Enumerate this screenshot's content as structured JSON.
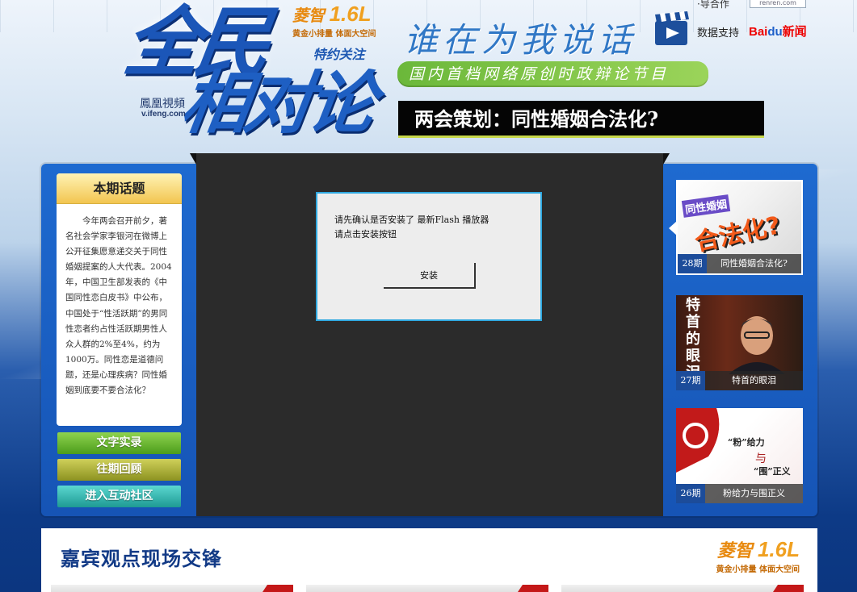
{
  "header": {
    "logo_main": "全民",
    "logo_sub": "相对论",
    "ifeng_cn": "鳳凰視頻",
    "ifeng_en": "v.ifeng.com",
    "sponsor_brand_a": "菱智",
    "sponsor_brand_b": "1.6L",
    "sponsor_line": "黄金小排量  体面大空间",
    "sponsor_tag": "特约关注",
    "slogan": "谁在为我说话",
    "data_support": "数据支持",
    "baidu_a": "Bai",
    "baidu_paw": "du",
    "baidu_b": "新闻",
    "top_right_mini": "·导合作",
    "top_right_badge": "renren.com",
    "tagline": "国内首档网络原创时政辩论节目",
    "topic_banner": "两会策划：同性婚姻合法化?"
  },
  "topic_card": {
    "heading": "本期话题",
    "body": "今年两会召开前夕，著名社会学家李银河在微博上公开征集愿意递交关于同性婚姻提案的人大代表。2004年，中国卫生部发表的《中国同性恋白皮书》中公布，中国处于“性活跃期”的男同性恋者约占性活跃期男性人众人群的2%至4%，约为1000万。同性恋是道德问题，还是心理疾病？同性婚姻到底要不要合法化？"
  },
  "side_buttons": {
    "transcript": "文字实录",
    "archive": "往期回顾",
    "community": "进入互动社区"
  },
  "flash_dialog": {
    "line1": "请先确认是否安装了 最新Flash 播放器",
    "line2": "请点击安装按钮",
    "install_label": "安装"
  },
  "episodes": [
    {
      "num": "28期",
      "title": "同性婚姻合法化?",
      "art_a": "同性婚姻",
      "art_b": "合法化?"
    },
    {
      "num": "27期",
      "title": "特首的眼泪",
      "art_a": "特首的眼泪"
    },
    {
      "num": "26期",
      "title": "粉给力与围正义",
      "art_a": "“粉”给力",
      "art_b": "与",
      "art_c": "“围”正义"
    }
  ],
  "guest_section": {
    "title": "嘉宾观点现场交锋",
    "sponsor_brand_a": "菱智",
    "sponsor_brand_b": "1.6L",
    "sponsor_line": "黄金小排量  体面大空间"
  },
  "colors": {
    "brand_blue": "#1b56b8",
    "topic_bar": "#050505",
    "tagline_green": "#6bb83a",
    "flash_border": "#2fa8e0"
  }
}
